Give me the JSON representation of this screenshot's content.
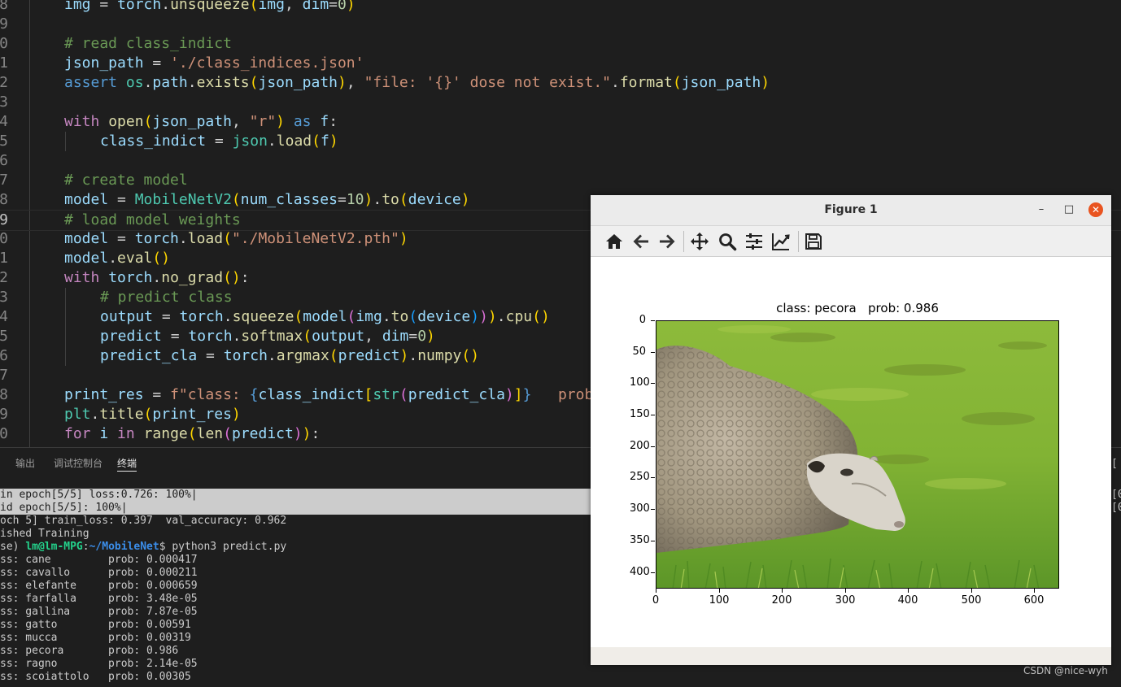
{
  "editor": {
    "line_numbers": [
      "8",
      "9",
      "0",
      "1",
      "2",
      "3",
      "4",
      "5",
      "6",
      "7",
      "8",
      "9",
      "0",
      "1",
      "2",
      "3",
      "4",
      "5",
      "6",
      "7",
      "8",
      "9",
      "0"
    ],
    "tokens": {
      "img": "img",
      "torch": "torch",
      "unsqueeze": "unsqueeze",
      "dim": "dim",
      "zero": "0",
      "comment_read": "# read class_indict",
      "json_path": "json_path",
      "json_file": "'./class_indices.json'",
      "assert": "assert",
      "os": "os",
      "path": "path",
      "exists": "exists",
      "fmt_str": "\"file: '{}' dose not exist.\"",
      "format": "format",
      "with": "with",
      "open": "open",
      "r_str": "\"r\"",
      "as": "as",
      "f": "f",
      "class_indict": "class_indict",
      "json": "json",
      "load": "load",
      "comment_create": "# create model",
      "model": "model",
      "MobileNetV2": "MobileNetV2",
      "num_classes": "num_classes",
      "ten": "10",
      "to": "to",
      "device": "device",
      "comment_load": "# load model weights",
      "pth_str": "\"./MobileNetV2.pth\"",
      "eval": "eval",
      "no_grad": "no_grad",
      "comment_predict": "# predict class",
      "output": "output",
      "squeeze": "squeeze",
      "cpu": "cpu",
      "predict": "predict",
      "softmax": "softmax",
      "predict_cla": "predict_cla",
      "argmax": "argmax",
      "numpy": "numpy",
      "print_res": "print_res",
      "fstr_start": "f\"class: ",
      "str": "str",
      "prob_tail": "   prob",
      "plt": "plt",
      "title": "title",
      "for": "for",
      "i": "i",
      "in": "in",
      "range": "range",
      "len": "len"
    }
  },
  "panel": {
    "tabs": [
      "输出",
      "调试控制台",
      "终端"
    ],
    "terminal": [
      {
        "text": "in epoch[5/5] loss:0.726: 100%|"
      },
      {
        "text": "id epoch[5/5]: 100%|"
      },
      {
        "text": "och 5] train_loss: 0.397  val_accuracy: 0.962"
      },
      {
        "text": "ished Training"
      },
      {
        "prompt_prefix": "se) ",
        "user": "lm@lm-MPG",
        "colon": ":",
        "path": "~/MobileNet",
        "cmd": "$ python3 predict.py"
      },
      {
        "text": "ss: cane         prob: 0.000417"
      },
      {
        "text": "ss: cavallo      prob: 0.000211"
      },
      {
        "text": "ss: elefante     prob: 0.000659"
      },
      {
        "text": "ss: farfalla     prob: 3.48e-05"
      },
      {
        "text": "ss: gallina      prob: 7.87e-05"
      },
      {
        "text": "ss: gatto        prob: 0.00591"
      },
      {
        "text": "ss: mucca        prob: 0.00319"
      },
      {
        "text": "ss: pecora       prob: 0.986"
      },
      {
        "text": "ss: ragno        prob: 2.14e-05"
      },
      {
        "text": "ss: scoiattolo   prob: 0.00305"
      }
    ],
    "right_edge": [
      "[",
      "[0",
      "[0"
    ]
  },
  "figure": {
    "window_title": "Figure 1",
    "controls": {
      "minimize": "–",
      "maximize": "□",
      "close": "✕"
    },
    "toolbar_icons": [
      "home-icon",
      "back-arrow-icon",
      "forward-arrow-icon",
      "pan-icon",
      "zoom-icon",
      "configure-subplots-icon",
      "edit-axis-icon",
      "save-icon"
    ],
    "plot_title": "class: pecora   prob: 0.986",
    "y_ticks": [
      "0",
      "50",
      "100",
      "150",
      "200",
      "250",
      "300",
      "350",
      "400"
    ],
    "x_ticks": [
      "0",
      "100",
      "200",
      "300",
      "400",
      "500",
      "600"
    ],
    "image_extent": {
      "width": 640,
      "height": 426
    },
    "colors": {
      "grass": "#8db83a",
      "sheep": "#a89c8a",
      "close": "#e95420"
    }
  },
  "watermark": "CSDN @nice-wyh"
}
